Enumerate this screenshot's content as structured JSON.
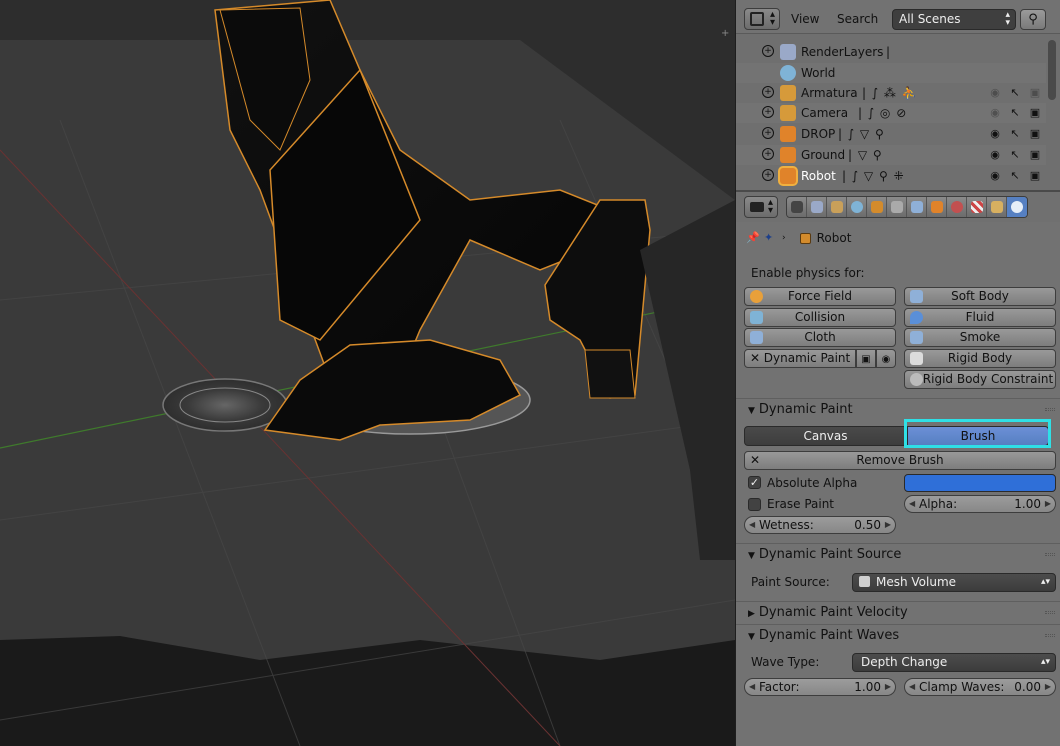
{
  "outliner": {
    "menu_view": "View",
    "menu_search": "Search",
    "scene_filter": "All Scenes",
    "partial_row": "render",
    "items": [
      {
        "name": "RenderLayers",
        "icon": "renderlayers-icon",
        "mods": "|",
        "icon_color": "#9aa9c8"
      },
      {
        "name": "World",
        "icon": "world-icon",
        "mods": "",
        "icon_color": "#7fb3d6"
      },
      {
        "name": "Armatura",
        "icon": "armature-icon",
        "mods": "|  ∫  ⁂  ⛹",
        "icon_color": "#d69a3a"
      },
      {
        "name": "Camera",
        "icon": "camera-icon",
        "mods": "|  ∫  ◎  ⊘",
        "icon_color": "#d69a3a"
      },
      {
        "name": "DROP",
        "icon": "mesh-icon",
        "mods": "|  ∫  ▽  ⚲",
        "icon_color": "#e0832a"
      },
      {
        "name": "Ground",
        "icon": "mesh-icon",
        "mods": "|  ▽  ⚲",
        "icon_color": "#e0832a"
      },
      {
        "name": "Robot",
        "icon": "mesh-icon",
        "mods": "|  ∫  ▽  ⚲  ⁜",
        "icon_color": "#e0832a",
        "selected": true
      }
    ]
  },
  "properties": {
    "breadcrumb_object": "Robot",
    "enable_physics_label": "Enable physics for:",
    "physics_left": [
      "Force Field",
      "Collision",
      "Cloth",
      "Dynamic Paint"
    ],
    "physics_right": [
      "Soft Body",
      "Fluid",
      "Smoke",
      "Rigid Body",
      "Rigid Body Constraint"
    ],
    "dynamic_paint": {
      "title": "Dynamic Paint",
      "tab_canvas": "Canvas",
      "tab_brush": "Brush",
      "remove_brush": "Remove Brush",
      "absolute_alpha": "Absolute Alpha",
      "absolute_alpha_checked": true,
      "paint_color": "#2f6fd8",
      "erase_paint": "Erase Paint",
      "erase_paint_checked": false,
      "alpha_label": "Alpha:",
      "alpha_value": "1.00",
      "wetness_label": "Wetness:",
      "wetness_value": "0.50"
    },
    "source_panel": {
      "title": "Dynamic Paint Source",
      "paint_source_label": "Paint Source:",
      "paint_source_value": "Mesh Volume"
    },
    "velocity_panel": {
      "title": "Dynamic Paint Velocity"
    },
    "waves_panel": {
      "title": "Dynamic Paint Waves",
      "wave_type_label": "Wave Type:",
      "wave_type_value": "Depth Change",
      "factor_label": "Factor:",
      "factor_value": "1.00",
      "clamp_label": "Clamp Waves:",
      "clamp_value": "0.00"
    }
  }
}
